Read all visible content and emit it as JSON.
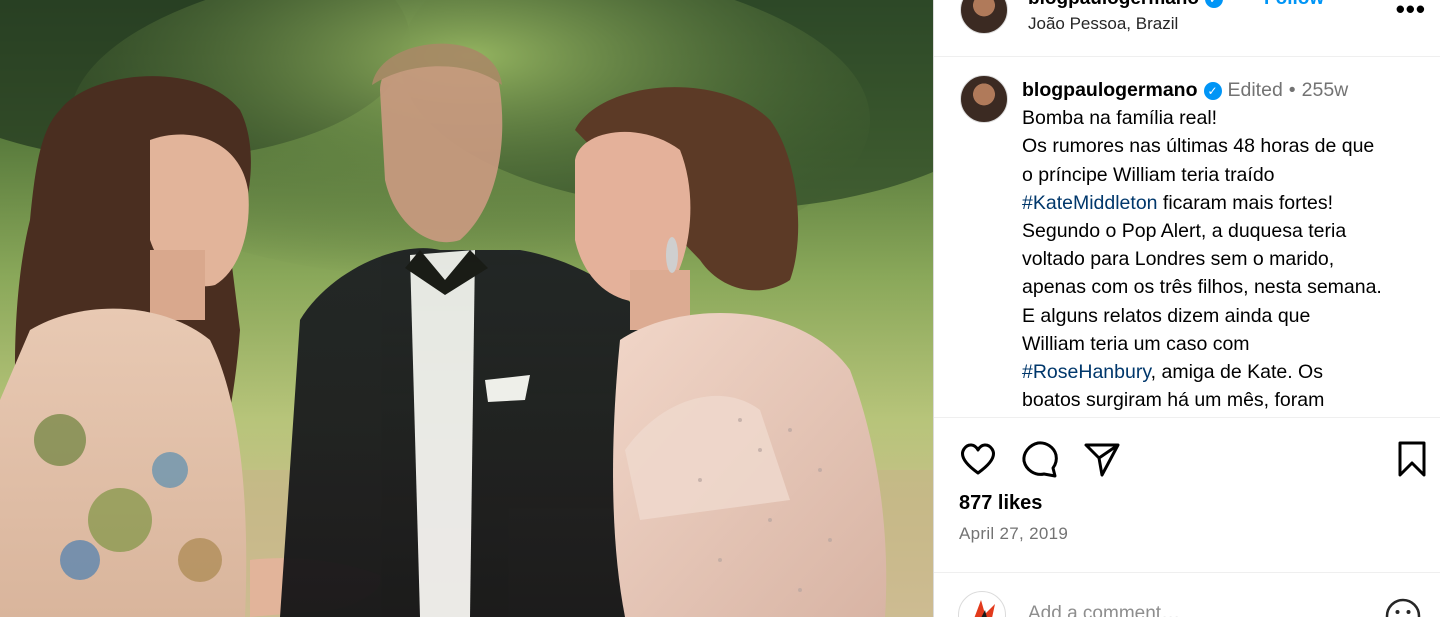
{
  "post": {
    "username": "blogpaulogermano",
    "follow_label": "Follow",
    "separator": "•",
    "location": "João Pessoa, Brazil",
    "more_icon": "more-horizontal-icon"
  },
  "caption": {
    "username": "blogpaulogermano",
    "edited": "Edited",
    "separator": "•",
    "time": "255w",
    "lines": [
      "Bomba na família real!",
      "Os rumores nas últimas 48 horas de que",
      "o príncipe William teria traído",
      {
        "hashtag": "#KateMiddleton",
        "rest": " ficaram mais fortes!"
      },
      "Segundo o Pop Alert, a duquesa teria",
      "voltado para Londres sem o marido,",
      "apenas com os três filhos, nesta semana.",
      "E alguns relatos dizem ainda que",
      "William teria um caso com",
      {
        "hashtag": "#RoseHanbury",
        "rest": ", amiga de Kate. Os"
      },
      "boatos surgiram há um mês, foram"
    ]
  },
  "actions": {
    "like_icon": "heart-icon",
    "comment_icon": "comment-bubble-icon",
    "share_icon": "paper-plane-icon",
    "save_icon": "bookmark-icon"
  },
  "likes_text": "877 likes",
  "date_text": "April 27, 2019",
  "comment": {
    "placeholder": "Add a comment…",
    "emoji_icon": "emoji-smile-icon"
  },
  "colors": {
    "accent": "#0095f6",
    "hashtag": "#00376b",
    "muted": "#737373"
  }
}
